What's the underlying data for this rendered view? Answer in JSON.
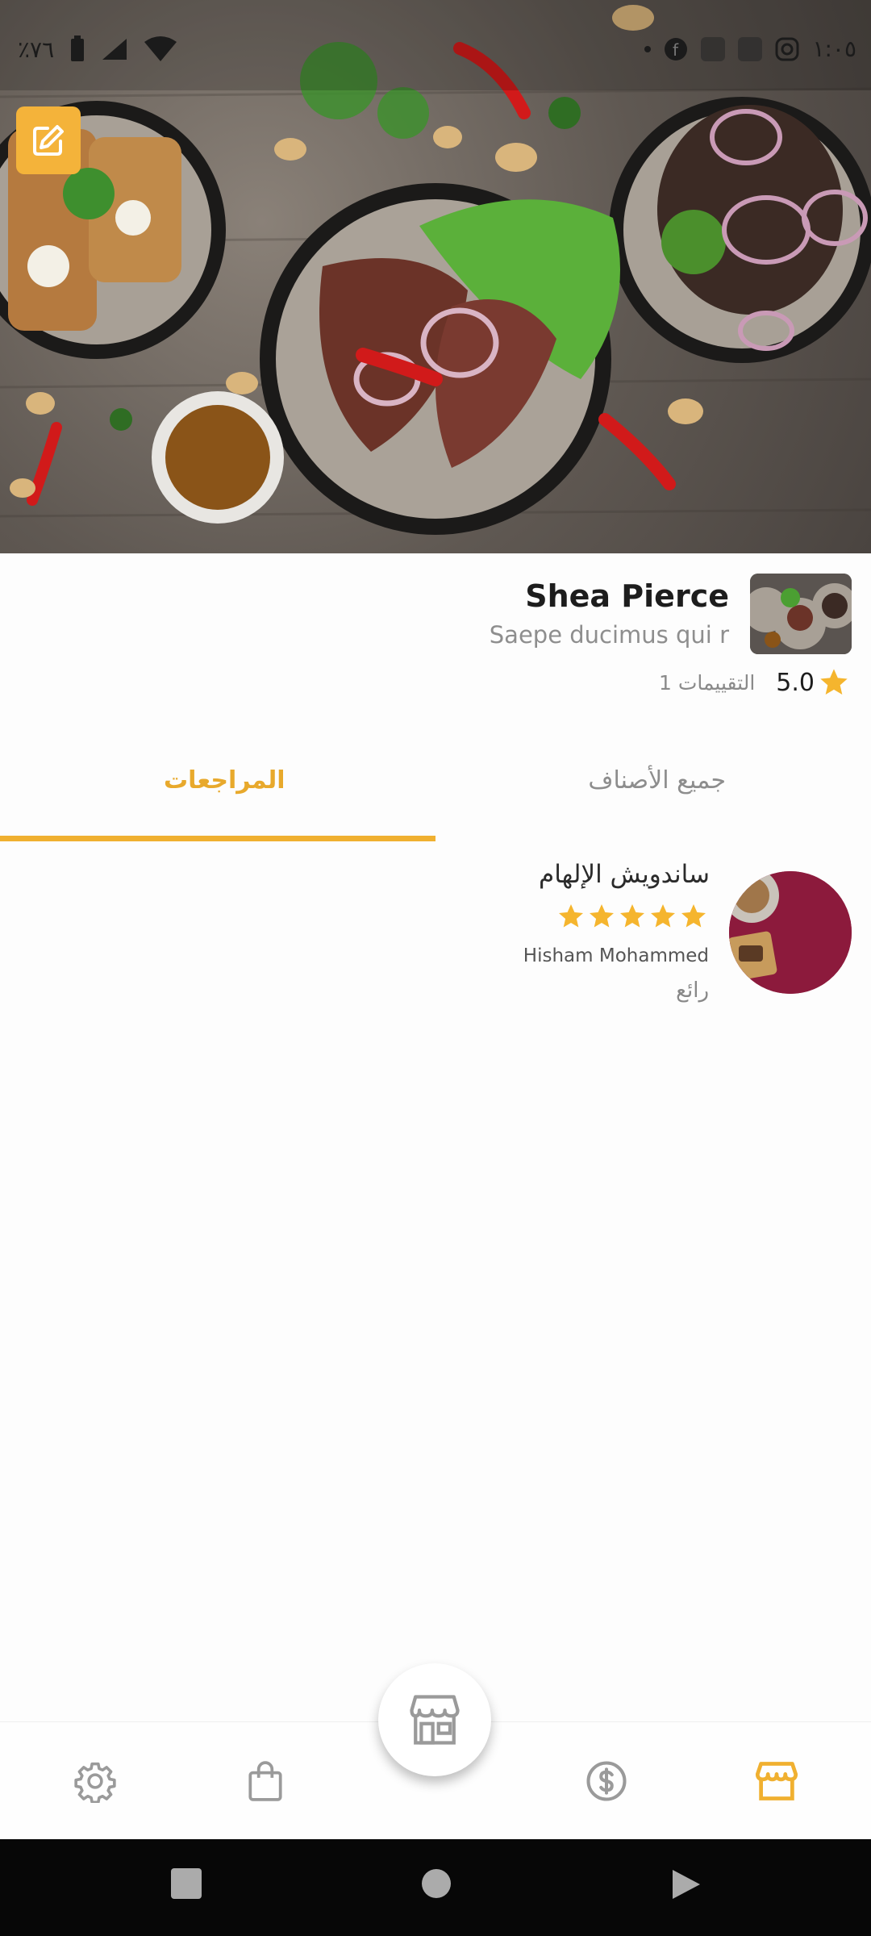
{
  "status_bar": {
    "battery": "٪٧٦",
    "time": "١:٠٥"
  },
  "store": {
    "name": "Shea Pierce",
    "description": "Saepe ducimus qui r",
    "rating": "5.0",
    "ratings_count": "1 التقييمات"
  },
  "tabs": {
    "all_items": "جميع الأصناف",
    "reviews": "المراجعات"
  },
  "review": {
    "title": "ساندويش الإلهام",
    "stars": 5,
    "author": "Hisham Mohammed",
    "text": "رائع"
  },
  "colors": {
    "accent": "#F0B030",
    "star": "#F5B52E",
    "tab_inactive": "#8D8D8D"
  },
  "bottom_nav": {
    "items": [
      "settings-icon",
      "shopping-bag-icon",
      "store-center-icon",
      "dollar-icon",
      "store-icon"
    ]
  }
}
